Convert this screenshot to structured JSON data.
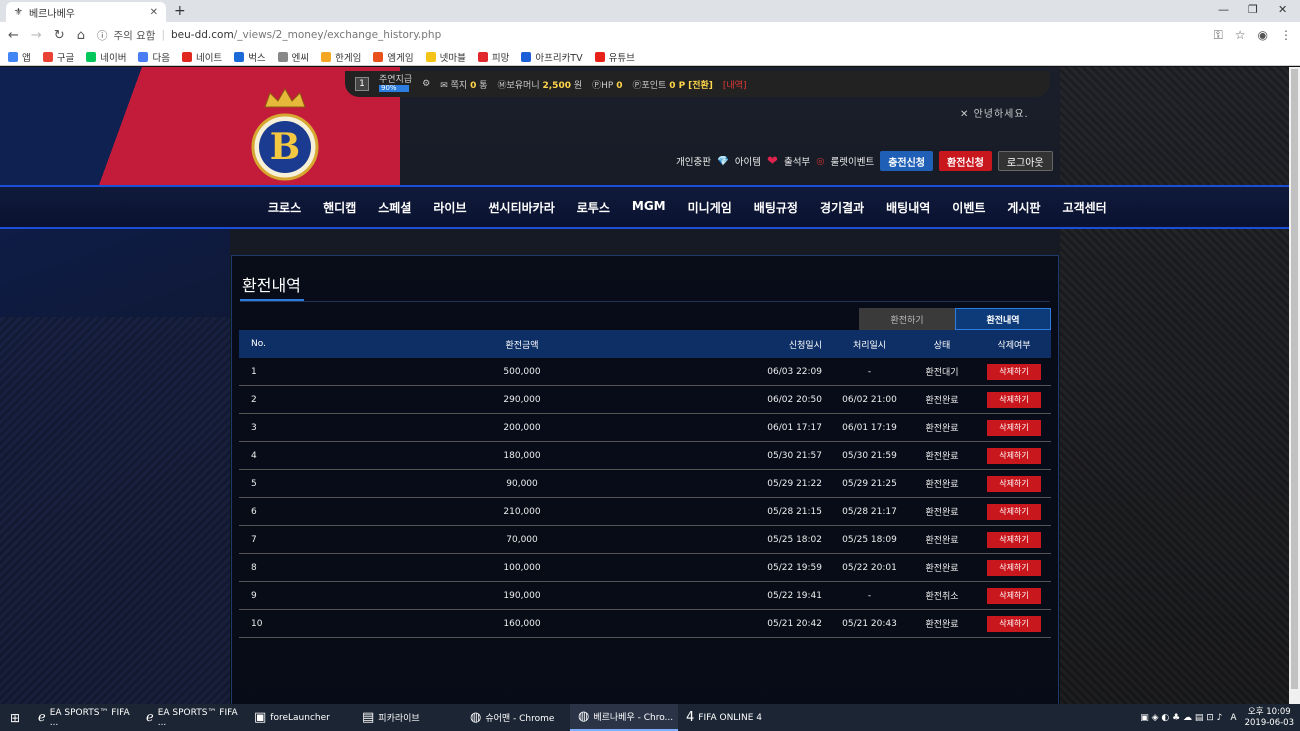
{
  "browser": {
    "tab_title": "베르나베우",
    "tab_close": "✕",
    "new_tab": "+",
    "window_controls": [
      "—",
      "❐",
      "✕"
    ],
    "security": "주의 요함",
    "url_domain": "beu-dd.com",
    "url_path": "/_views/2_money/exchange_history.php",
    "bookmarks": [
      {
        "label": "앱",
        "color": "#4285f4"
      },
      {
        "label": "구글",
        "color": "#ea4335"
      },
      {
        "label": "네이버",
        "color": "#03c75a"
      },
      {
        "label": "다음",
        "color": "#4a7cf4"
      },
      {
        "label": "네이트",
        "color": "#e0281e"
      },
      {
        "label": "벅스",
        "color": "#1a6ad8"
      },
      {
        "label": "엔씨",
        "color": "#888888"
      },
      {
        "label": "한게임",
        "color": "#f5a623"
      },
      {
        "label": "엠게임",
        "color": "#e8501c"
      },
      {
        "label": "넷마블",
        "color": "#f3c416"
      },
      {
        "label": "피망",
        "color": "#e0282e"
      },
      {
        "label": "아프리카TV",
        "color": "#1b5fd8"
      },
      {
        "label": "유튜브",
        "color": "#e62117"
      }
    ]
  },
  "topstrip": {
    "level": "1",
    "level_name": "주연지급",
    "level_pct": "90%",
    "message_label": "쪽지",
    "message_count": "0",
    "message_unit": "통",
    "money_label": "보유머니",
    "money_value": "2,500",
    "money_unit": "원",
    "hp_label": "HP",
    "hp_value": "0",
    "point_label": "포인트",
    "point_value": "0 P",
    "point_convert": "[전환]",
    "point_history": "[내역]"
  },
  "greeting": "안녕하세요.",
  "userbar": {
    "personal": "개인충판",
    "items": "아이템",
    "attendance": "출석부",
    "roulette": "룰렛이벤트",
    "charge_btn": "충전신청",
    "exchange_btn": "환전신청",
    "logout_btn": "로그아웃"
  },
  "nav": [
    "크로스",
    "핸디캡",
    "스페셜",
    "라이브",
    "썬시티바카라",
    "로투스",
    "MGM",
    "미니게임",
    "배팅규정",
    "경기결과",
    "배팅내역",
    "이벤트",
    "게시판",
    "고객센터"
  ],
  "panel": {
    "title": "환전내역",
    "tab_do": "환전하기",
    "tab_history": "환전내역",
    "headers": [
      "No.",
      "환전금액",
      "신청일시",
      "처리일시",
      "상태",
      "삭제여부"
    ],
    "delete_label": "삭제하기",
    "rows": [
      {
        "no": "1",
        "amount": "500,000",
        "req": "06/03 22:09",
        "proc": "-",
        "status": "환전대기"
      },
      {
        "no": "2",
        "amount": "290,000",
        "req": "06/02 20:50",
        "proc": "06/02 21:00",
        "status": "환전완료"
      },
      {
        "no": "3",
        "amount": "200,000",
        "req": "06/01 17:17",
        "proc": "06/01 17:19",
        "status": "환전완료"
      },
      {
        "no": "4",
        "amount": "180,000",
        "req": "05/30 21:57",
        "proc": "05/30 21:59",
        "status": "환전완료"
      },
      {
        "no": "5",
        "amount": "90,000",
        "req": "05/29 21:22",
        "proc": "05/29 21:25",
        "status": "환전완료"
      },
      {
        "no": "6",
        "amount": "210,000",
        "req": "05/28 21:15",
        "proc": "05/28 21:17",
        "status": "환전완료"
      },
      {
        "no": "7",
        "amount": "70,000",
        "req": "05/25 18:02",
        "proc": "05/25 18:09",
        "status": "환전완료"
      },
      {
        "no": "8",
        "amount": "100,000",
        "req": "05/22 19:59",
        "proc": "05/22 20:01",
        "status": "환전완료"
      },
      {
        "no": "9",
        "amount": "190,000",
        "req": "05/22 19:41",
        "proc": "-",
        "status": "환전취소"
      },
      {
        "no": "10",
        "amount": "160,000",
        "req": "05/21 20:42",
        "proc": "05/21 20:43",
        "status": "환전완료"
      }
    ]
  },
  "taskbar": {
    "tasks": [
      "EA SPORTS™ FIFA ...",
      "EA SPORTS™ FIFA ...",
      "foreLauncher",
      "피카라이브",
      "슈어맨 - Chrome",
      "베르나베우 - Chro...",
      "FIFA ONLINE 4"
    ],
    "time": "오후 10:09",
    "date": "2019-06-03",
    "ime": "A"
  }
}
